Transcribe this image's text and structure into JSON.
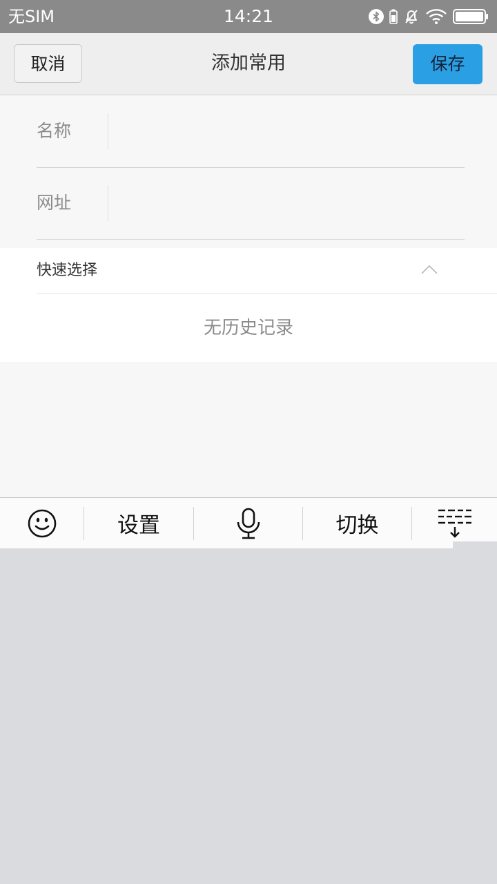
{
  "status_bar": {
    "carrier": "无SIM",
    "time": "14:21",
    "icons": [
      "bluetooth-icon",
      "battery-saver-icon",
      "mute-bell-icon",
      "wifi-icon",
      "battery-icon"
    ]
  },
  "header": {
    "cancel_label": "取消",
    "title": "添加常用",
    "save_label": "保存"
  },
  "form": {
    "name_label": "名称",
    "name_value": "",
    "url_label": "网址",
    "url_value": ""
  },
  "quick_select": {
    "title": "快速选择",
    "empty_text": "无历史记录"
  },
  "keyboard_toolbar": {
    "items": [
      {
        "icon": "emoji-icon"
      },
      {
        "label": "设置"
      },
      {
        "icon": "microphone-icon"
      },
      {
        "label": "切换"
      },
      {
        "icon": "keyboard-collapse-icon"
      }
    ]
  },
  "colors": {
    "status_bar_bg": "#8a8a8a",
    "header_bg": "#eeeeee",
    "save_button_bg": "#2a9fe4",
    "page_bg": "#f7f7f7",
    "keyboard_bg": "#dadbdf"
  }
}
